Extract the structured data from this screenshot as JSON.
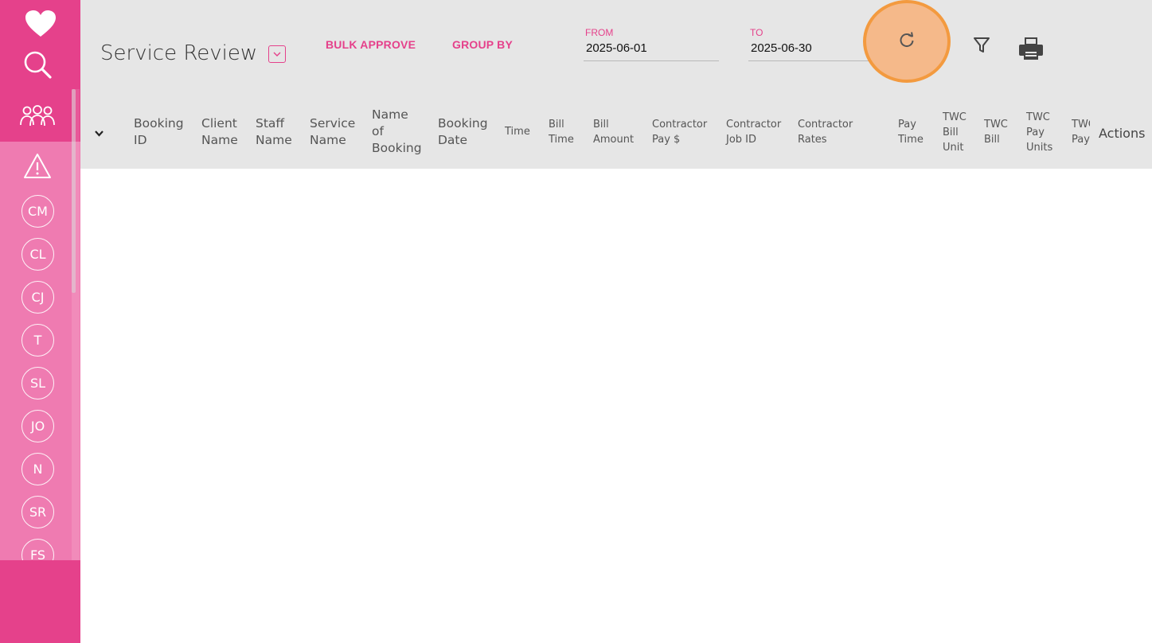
{
  "colors": {
    "brand": "#e5418b",
    "brand_light": "#ef7bb1",
    "header_bg": "#e6e6e6",
    "highlight_fill": "#f5b98a",
    "highlight_ring": "#f39a3f"
  },
  "sidebar": {
    "top_icons": [
      "heart-logo-icon",
      "search-icon",
      "users-icon",
      "alert-icon"
    ],
    "avatars": [
      "CM",
      "CL",
      "CJ",
      "T",
      "SL",
      "JO",
      "N",
      "SR",
      "FS"
    ]
  },
  "header": {
    "title": "Service Review",
    "bulk_approve": "BULK APPROVE",
    "group_by": "GROUP BY",
    "from": {
      "label": "FROM",
      "value": "2025-06-01"
    },
    "to": {
      "label": "TO",
      "value": "2025-06-30"
    },
    "icons": [
      "refresh-icon",
      "filter-icon",
      "print-icon"
    ]
  },
  "table": {
    "columns": [
      "Booking ID",
      "Client Name",
      "Staff Name",
      "Service Name",
      "Name of Booking",
      "Booking Date",
      "Time",
      "Bill Time",
      "Bill Amount",
      "Contractor Pay $",
      "Contractor Job ID",
      "Contractor Rates",
      "Pay Time",
      "TWC Bill Unit",
      "TWC Bill",
      "TWC Pay Units",
      "TWC Pay",
      "Actions"
    ],
    "header_lines": {
      "booking_id": [
        "Booking",
        "ID"
      ],
      "client_name": [
        "Client",
        "Name"
      ],
      "staff_name": [
        "Staff",
        "Name"
      ],
      "service_name": [
        "Service",
        "Name"
      ],
      "name_of_booking": [
        "Name",
        "of",
        "Booking"
      ],
      "booking_date": [
        "Booking",
        "Date"
      ],
      "time": [
        "Time"
      ],
      "bill_time": [
        "Bill",
        "Time"
      ],
      "bill_amount": [
        "Bill",
        "Amount"
      ],
      "contractor_pay": [
        "Contractor",
        "Pay $"
      ],
      "contractor_job_id": [
        "Contractor",
        "Job ID"
      ],
      "contractor_rates": [
        "Contractor",
        "Rates"
      ],
      "pay_time": [
        "Pay",
        "Time"
      ],
      "twc_bill_unit": [
        "TWC",
        "Bill",
        "Unit"
      ],
      "twc_bill": [
        "TWC",
        "Bill"
      ],
      "twc_pay_units": [
        "TWC",
        "Pay",
        "Units"
      ],
      "twc_pay": [
        "TWC",
        "Pay"
      ],
      "actions": [
        "Actions"
      ]
    },
    "rows": []
  }
}
